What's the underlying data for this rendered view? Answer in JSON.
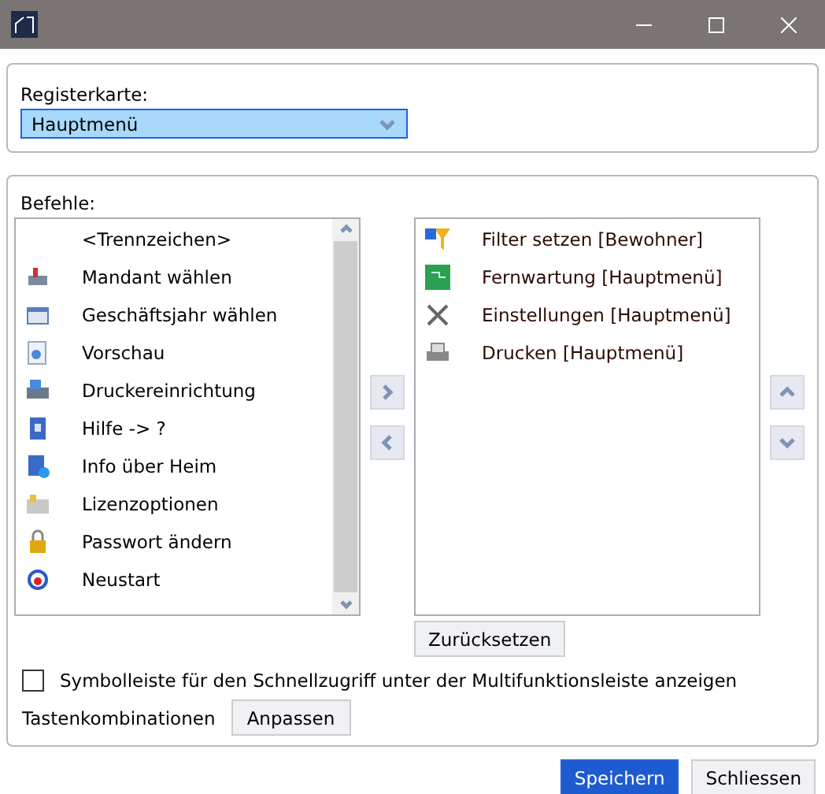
{
  "tab_group": {
    "label": "Registerkarte:",
    "value": "Hauptmenü"
  },
  "commands": {
    "label": "Befehle:",
    "available": [
      "<Trennzeichen>",
      "Mandant wählen",
      "Geschäftsjahr wählen",
      "Vorschau",
      "Druckereinrichtung",
      "Hilfe -> ?",
      "Info über Heim",
      "Lizenzoptionen",
      "Passwort ändern",
      "Neustart"
    ],
    "chosen": [
      "Filter setzen [Bewohner]",
      "Fernwartung [Hauptmenü]",
      "Einstellungen [Hauptmenü]",
      "Drucken [Hauptmenü]"
    ],
    "reset_button": "Zurücksetzen"
  },
  "quick_access": {
    "label": "Symbolleiste für den Schnellzugriff unter der Multifunktionsleiste anzeigen",
    "checked": false
  },
  "shortcuts": {
    "label": "Tastenkombinationen",
    "button": "Anpassen"
  },
  "buttons": [
    {
      "label": "Speichern",
      "primary": true
    },
    {
      "label": "Schliessen",
      "primary": false
    }
  ]
}
